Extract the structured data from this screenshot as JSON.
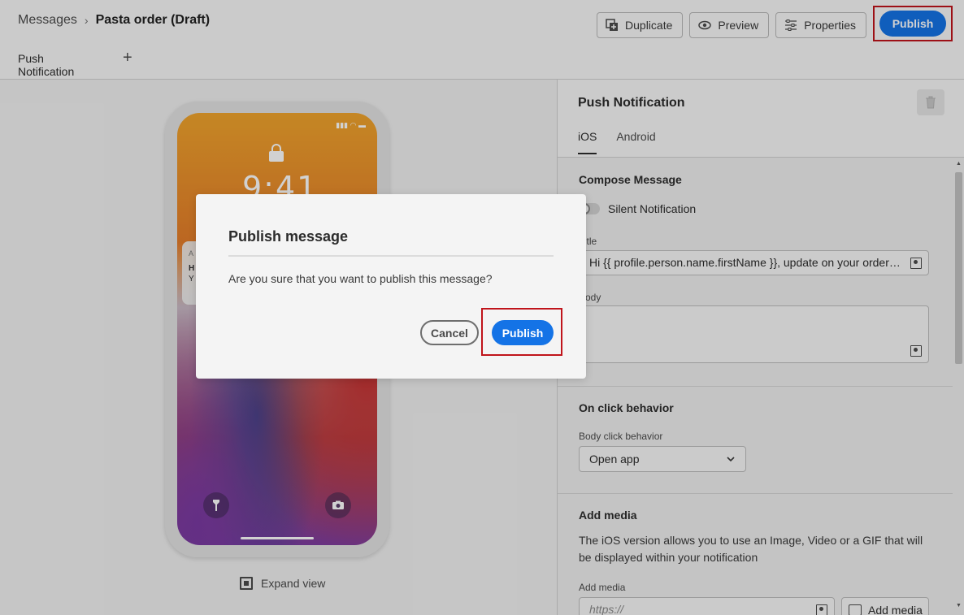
{
  "header": {
    "breadcrumb_root": "Messages",
    "breadcrumb_sep": "›",
    "breadcrumb_current": "Pasta order (Draft)",
    "duplicate_label": "Duplicate",
    "preview_label": "Preview",
    "properties_label": "Properties",
    "publish_label": "Publish"
  },
  "tabs": {
    "push_label": "Push Notification",
    "add_label": "+"
  },
  "preview": {
    "status_icons": "▮▮▮ ◠ ▬",
    "time": "9:41",
    "notif_app": "A",
    "notif_title": "H",
    "notif_body": "Y",
    "expand_label": "Expand view"
  },
  "panel": {
    "title": "Push Notification",
    "tabs": [
      {
        "label": "iOS",
        "active": true
      },
      {
        "label": "Android",
        "active": false
      }
    ],
    "compose_title": "Compose Message",
    "silent_label": "Silent Notification",
    "title_label": "Title",
    "title_value": "Hi {{ profile.person.name.firstName }}, update on your order:cont...",
    "body_label": "Body",
    "body_value": "",
    "click_title": "On click behavior",
    "click_label": "Body click behavior",
    "click_value": "Open app",
    "media_title": "Add media",
    "media_desc": "The iOS version allows you to use an Image, Video or a GIF that will be displayed within your notification",
    "media_label": "Add media",
    "media_placeholder": "https://",
    "media_button": "Add media"
  },
  "dialog": {
    "title": "Publish message",
    "body": "Are you sure that you want to publish this message?",
    "cancel_label": "Cancel",
    "publish_label": "Publish"
  },
  "colors": {
    "accent": "#1473e6",
    "highlight": "#c0141b"
  }
}
